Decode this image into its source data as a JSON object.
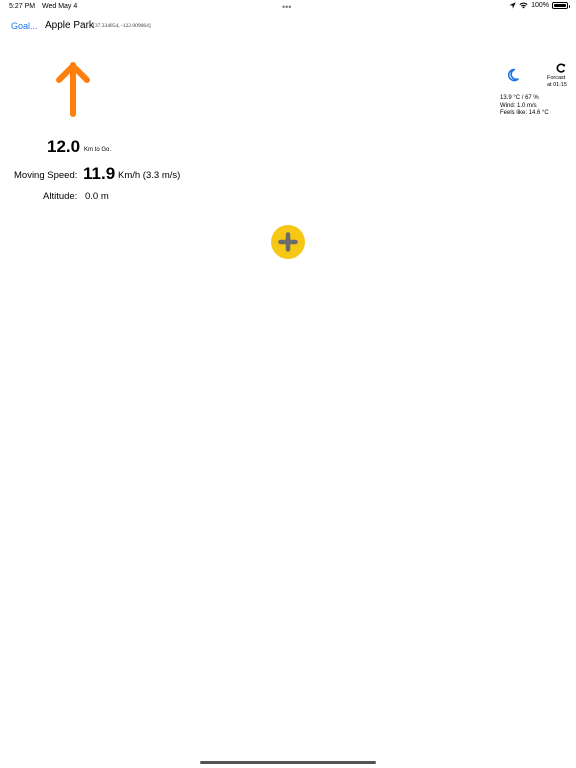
{
  "status_bar": {
    "time": "5:27 PM",
    "date": "Wed May 4",
    "multitask_dots": "•••",
    "battery": "100%",
    "battery_level": 1.0,
    "icons": [
      "location-arrow-icon",
      "wifi-icon",
      "battery-icon"
    ]
  },
  "nav": {
    "goal_button": "Goal...",
    "title": "Apple Park",
    "coordinates": "[37.334854, -122.009064]"
  },
  "arrow": {
    "icon": "arrow-up-icon",
    "color": "#ff7f0e"
  },
  "distance": {
    "value": "12.0",
    "unit": "Km to Go."
  },
  "speed": {
    "label": "Moving Speed:",
    "value": "11.9",
    "unit": "Km/h (3.3 m/s)"
  },
  "altitude": {
    "label": "Altitude:",
    "value": "0.0 m"
  },
  "weather": {
    "condition_icon": "moon-icon",
    "refresh_icon": "refresh-icon",
    "forecast_label": "Forcast",
    "forecast_time": "at 01:15",
    "temp_humidity": "13.9 °C / 67 %",
    "wind": "Wind: 1.0 m/s",
    "feels_like": "Feels like: 14.6 °C",
    "accent_color": "#1a73e8"
  },
  "add_button": {
    "icon": "plus-icon",
    "color": "#f6c815"
  }
}
